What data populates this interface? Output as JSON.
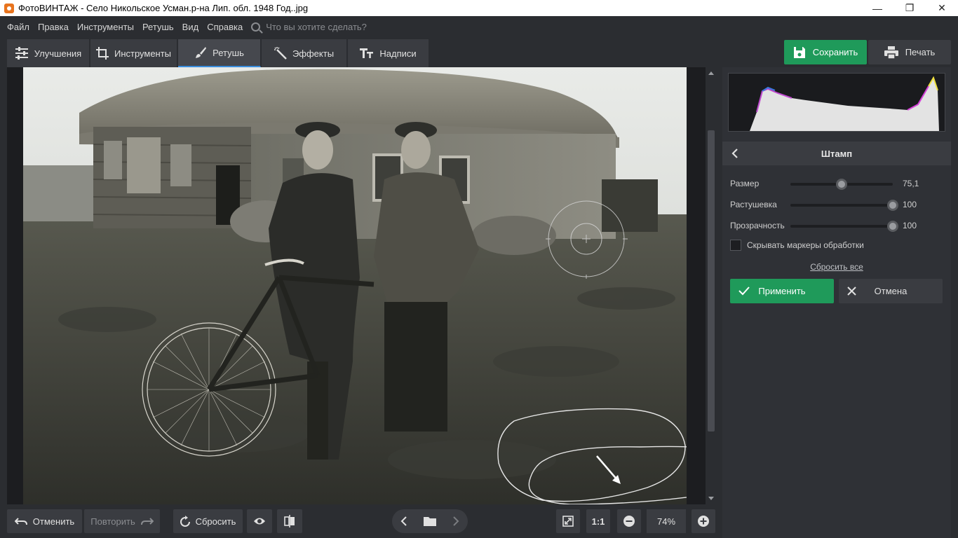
{
  "window": {
    "title": "ФотоВИНТАЖ - Село Никольское Усман.р-на Лип. обл. 1948 Год..jpg",
    "minimize": "—",
    "maximize": "❐",
    "close": "✕"
  },
  "menu": {
    "items": [
      "Файл",
      "Правка",
      "Инструменты",
      "Ретушь",
      "Вид",
      "Справка"
    ],
    "search_placeholder": "Что вы хотите сделать?"
  },
  "tabs": [
    {
      "label": "Улучшения",
      "icon": "sliders-icon"
    },
    {
      "label": "Инструменты",
      "icon": "crop-icon"
    },
    {
      "label": "Ретушь",
      "icon": "brush-icon",
      "active": true
    },
    {
      "label": "Эффекты",
      "icon": "magic-wand-icon"
    },
    {
      "label": "Надписи",
      "icon": "text-icon"
    }
  ],
  "actions": {
    "save": "Сохранить",
    "print": "Печать"
  },
  "panel": {
    "title": "Штамп",
    "params": [
      {
        "label": "Размер",
        "value": "75,1",
        "fraction": 0.5
      },
      {
        "label": "Растушевка",
        "value": "100",
        "fraction": 1.0
      },
      {
        "label": "Прозрачность",
        "value": "100",
        "fraction": 1.0
      }
    ],
    "hide_markers_label": "Скрывать маркеры обработки",
    "hide_markers_checked": false,
    "reset_all": "Сбросить все",
    "apply": "Применить",
    "cancel": "Отмена"
  },
  "bottom": {
    "undo": "Отменить",
    "redo": "Повторить",
    "reset": "Сбросить",
    "one_to_one": "1:1",
    "zoom": "74%"
  },
  "colors": {
    "accent_green": "#1f9a5a",
    "active_tab_underline": "#3b8ede",
    "panel_bg": "#2f3136"
  }
}
